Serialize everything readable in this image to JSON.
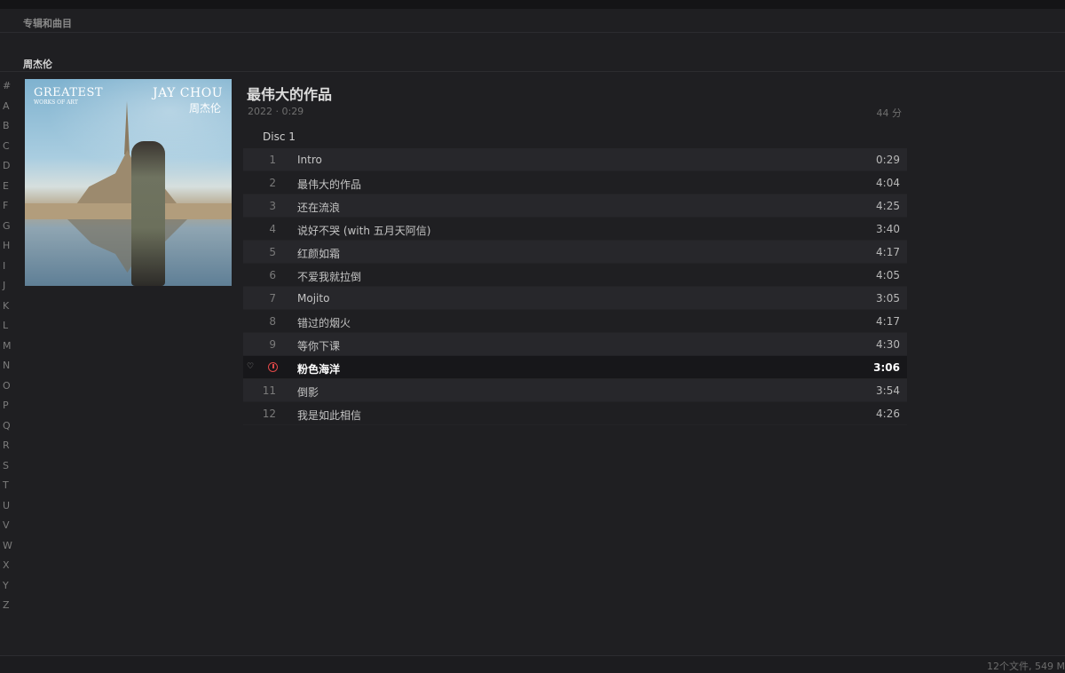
{
  "header": {
    "title": "专辑和曲目"
  },
  "artist": {
    "name": "周杰伦"
  },
  "alpha_index": [
    "#",
    "A",
    "B",
    "C",
    "D",
    "E",
    "F",
    "G",
    "H",
    "I",
    "J",
    "K",
    "L",
    "M",
    "N",
    "O",
    "P",
    "Q",
    "R",
    "S",
    "T",
    "U",
    "V",
    "W",
    "X",
    "Y",
    "Z"
  ],
  "album": {
    "title": "最伟大的作品",
    "meta": "2022 · 0:29",
    "duration": "44 分",
    "cover_text": {
      "greatest": "GREATEST",
      "works": "WORKS OF ART",
      "artist_en": "JAY CHOU",
      "artist_cn": "周杰伦"
    }
  },
  "disc": {
    "label": "Disc 1"
  },
  "tracks": [
    {
      "num": "1",
      "title": "Intro",
      "duration": "0:29"
    },
    {
      "num": "2",
      "title": "最伟大的作品",
      "duration": "4:04"
    },
    {
      "num": "3",
      "title": "还在流浪",
      "duration": "4:25"
    },
    {
      "num": "4",
      "title": "说好不哭 (with 五月天阿信)",
      "duration": "3:40"
    },
    {
      "num": "5",
      "title": "红颜如霜",
      "duration": "4:17"
    },
    {
      "num": "6",
      "title": "不爱我就拉倒",
      "duration": "4:05"
    },
    {
      "num": "7",
      "title": "Mojito",
      "duration": "3:05"
    },
    {
      "num": "8",
      "title": "错过的烟火",
      "duration": "4:17"
    },
    {
      "num": "9",
      "title": "等你下课",
      "duration": "4:30"
    },
    {
      "num": "",
      "title": "粉色海洋",
      "duration": "3:06",
      "playing": true
    },
    {
      "num": "11",
      "title": "倒影",
      "duration": "3:54"
    },
    {
      "num": "12",
      "title": "我是如此相信",
      "duration": "4:26"
    }
  ],
  "status": {
    "text": "12个文件, 549 M"
  },
  "colors": {
    "background": "#1f1f22",
    "row_alt": "#27272b",
    "playing_accent": "#e04848"
  }
}
